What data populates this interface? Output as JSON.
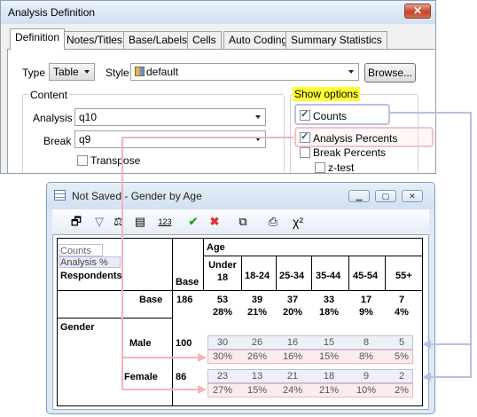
{
  "dialog": {
    "title": "Analysis Definition",
    "close_symbol": "✕",
    "tabs": [
      "Definition",
      "Notes/Titles",
      "Base/Labels",
      "Cells",
      "Auto Coding",
      "Summary Statistics"
    ],
    "type_label": "Type",
    "type_value": "Table",
    "style_label": "Style",
    "style_value": "default",
    "browse_label": "Browse...",
    "content_legend": "Content",
    "analysis_label": "Analysis",
    "analysis_value": "q10",
    "break_label": "Break",
    "break_value": "q9",
    "transpose_label": "Transpose",
    "show_options_label": "Show options",
    "options": [
      {
        "label": "Counts",
        "checked": true
      },
      {
        "label": "Analysis Percents",
        "checked": true
      },
      {
        "label": "Break Percents",
        "checked": false
      },
      {
        "label": "z-test",
        "checked": false
      }
    ]
  },
  "window": {
    "title": "Not Saved - Gender by Age",
    "controls": [
      "minimize",
      "maximize",
      "close"
    ],
    "toolbar_icons": [
      "edit-table-icon",
      "filter-icon",
      "weight-icon",
      "labels-icon",
      "numbering-icon",
      "accept-icon",
      "reject-icon",
      "copy-icon",
      "print-icon",
      "chi-square-icon"
    ],
    "numbering_text": "123",
    "chi_text": "χ²",
    "legend": {
      "counts": "Counts",
      "analysis": "Analysis %",
      "respondents": "Respondents"
    },
    "table": {
      "age_header": "Age",
      "base_header": "Base",
      "columns": [
        "Under 18",
        "18-24",
        "25-34",
        "35-44",
        "45-54",
        "55+"
      ],
      "base_row": {
        "label": "Base",
        "base": "186",
        "values": [
          "53",
          "39",
          "37",
          "33",
          "17",
          "7"
        ],
        "pcts": [
          "28%",
          "21%",
          "20%",
          "18%",
          "9%",
          "4%"
        ]
      },
      "gender_label": "Gender",
      "rows": [
        {
          "label": "Male",
          "base": "100",
          "counts": [
            "30",
            "26",
            "16",
            "15",
            "8",
            "5"
          ],
          "pcts": [
            "30%",
            "26%",
            "16%",
            "15%",
            "8%",
            "5%"
          ]
        },
        {
          "label": "Female",
          "base": "86",
          "counts": [
            "23",
            "13",
            "21",
            "18",
            "9",
            "2"
          ],
          "pcts": [
            "27%",
            "15%",
            "24%",
            "21%",
            "10%",
            "2%"
          ]
        }
      ]
    }
  },
  "colors": {
    "highlight_yellow": "#ffff33",
    "counts_connector": "#b8bfe0",
    "percents_connector": "#efb6b6"
  }
}
